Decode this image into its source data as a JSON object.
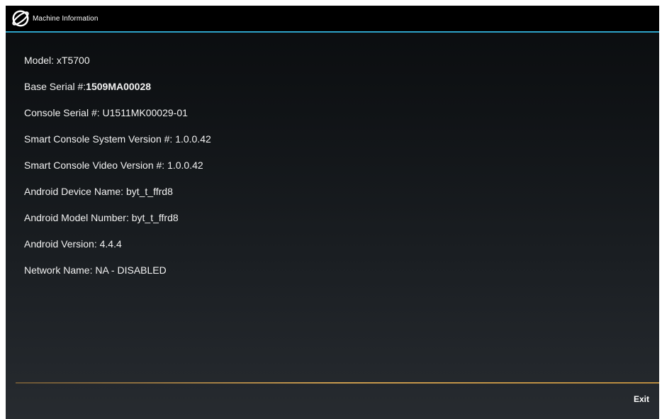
{
  "window": {
    "title": "Machine Information",
    "logo_icon": "brand-logo-icon",
    "accent_color": "#2ea3c9"
  },
  "info": {
    "model": {
      "label": "Model: ",
      "value": "xT5700"
    },
    "base_serial": {
      "label": "Base Serial #:",
      "value": "1509MA00028"
    },
    "console_serial": {
      "label": "Console Serial #: ",
      "value": "U1511MK00029-01"
    },
    "system_version": {
      "label": "Smart Console System Version #: ",
      "value": "1.0.0.42"
    },
    "video_version": {
      "label": "Smart Console Video Version #: ",
      "value": "1.0.0.42"
    },
    "device_name": {
      "label": "Android Device Name: ",
      "value": "byt_t_ffrd8"
    },
    "model_number": {
      "label": "Android Model Number: ",
      "value": "byt_t_ffrd8"
    },
    "android_version": {
      "label": "Android Version: ",
      "value": "4.4.4"
    },
    "network_name": {
      "label": "Network Name: ",
      "value": "NA - DISABLED"
    }
  },
  "footer": {
    "exit_label": "Exit",
    "divider_color": "#c89a4e"
  }
}
